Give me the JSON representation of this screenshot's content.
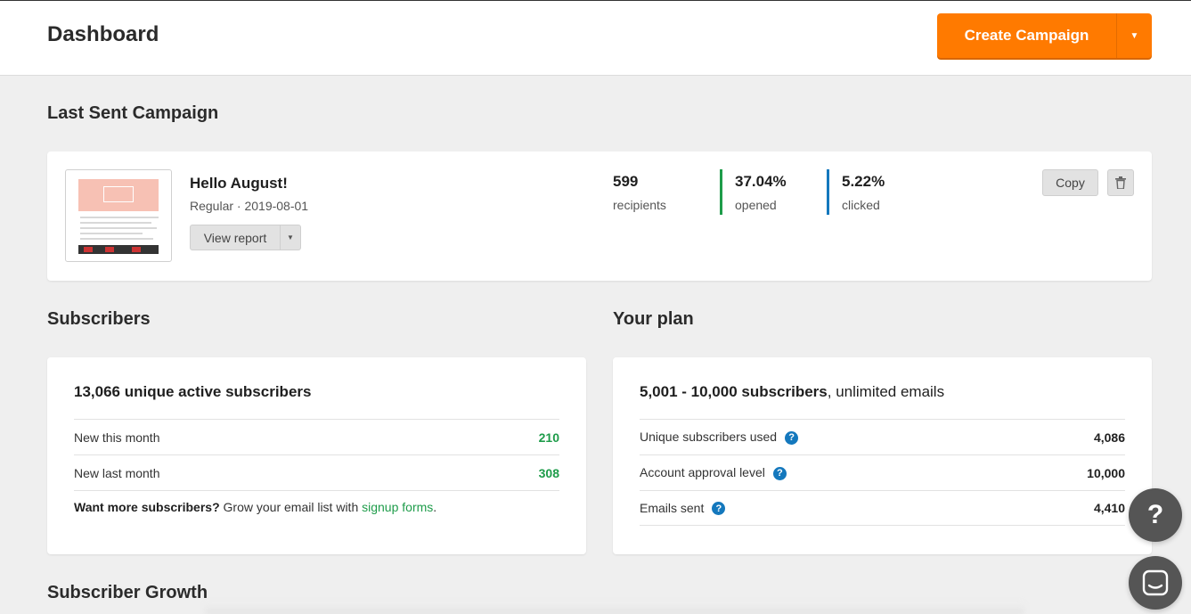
{
  "header": {
    "title": "Dashboard",
    "create_label": "Create Campaign"
  },
  "last_campaign": {
    "section_title": "Last Sent Campaign",
    "name": "Hello August!",
    "meta": "Regular · 2019-08-01",
    "view_report_label": "View report",
    "stats": [
      {
        "value": "599",
        "label": "recipients"
      },
      {
        "value": "37.04%",
        "label": "opened",
        "color": "#1e9c4a"
      },
      {
        "value": "5.22%",
        "label": "clicked",
        "color": "#1478bd"
      }
    ],
    "copy_label": "Copy"
  },
  "subscribers": {
    "section_title": "Subscribers",
    "headline": "13,066 unique active subscribers",
    "rows": [
      {
        "label": "New this month",
        "value": "210"
      },
      {
        "label": "New last month",
        "value": "308"
      }
    ],
    "promo_bold": "Want more subscribers?",
    "promo_text": " Grow your email list with ",
    "promo_link": "signup forms",
    "promo_end": "."
  },
  "plan": {
    "section_title": "Your plan",
    "headline_bold": "5,001 - 10,000 subscribers",
    "headline_rest": ", unlimited emails",
    "rows": [
      {
        "label": "Unique subscribers used",
        "value": "4,086"
      },
      {
        "label": "Account approval level",
        "value": "10,000"
      },
      {
        "label": "Emails sent",
        "value": "4,410"
      }
    ]
  },
  "growth": {
    "section_title": "Subscriber Growth"
  },
  "floating": {
    "help_glyph": "?"
  }
}
